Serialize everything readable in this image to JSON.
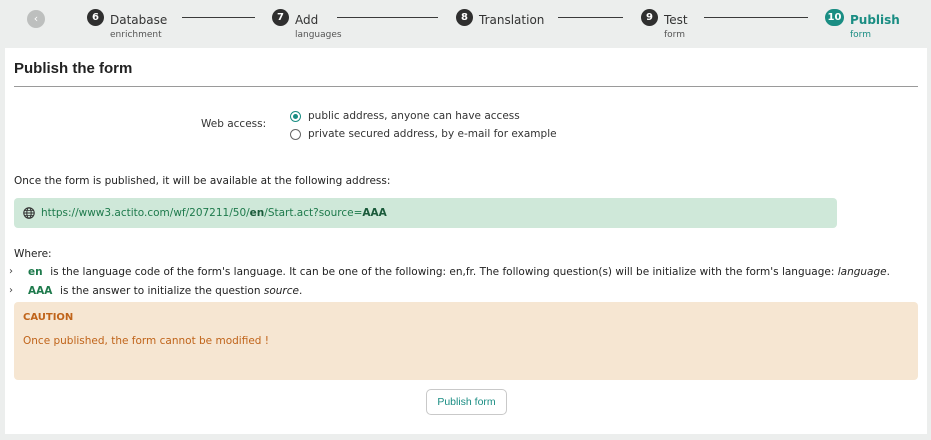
{
  "stepper": {
    "back_icon": "chevron-left-icon",
    "steps": [
      {
        "num": "6",
        "title": "Database",
        "sub": "enrichment"
      },
      {
        "num": "7",
        "title": "Add",
        "sub": "languages"
      },
      {
        "num": "8",
        "title": "Translation",
        "sub": ""
      },
      {
        "num": "9",
        "title": "Test",
        "sub": "form"
      },
      {
        "num": "10",
        "title": "Publish",
        "sub": "form"
      }
    ],
    "active_step": "10",
    "accent_color": "#1a8d83"
  },
  "page": {
    "title": "Publish the form"
  },
  "web_access": {
    "label": "Web access:",
    "options": [
      {
        "label": "public address, anyone can have access",
        "checked": true
      },
      {
        "label": "private secured address, by e-mail for example",
        "checked": false
      }
    ]
  },
  "address": {
    "intro": "Once the form is published, it will be available at the following address:",
    "icon": "globe-icon",
    "url_prefix": "https://www3.actito.com/wf/207211/50/",
    "url_lang": "en",
    "url_middle": "/Start.act?source=",
    "url_param": "AAA"
  },
  "where": {
    "label": "Where:",
    "items": [
      {
        "code": "en",
        "text": "is the language code of the form's language. It can be one of the following: en,fr. The following question(s) will be initialize with the form's language:",
        "emph": "language",
        "tail": "."
      },
      {
        "code": "AAA",
        "text": "is the answer to initialize the question",
        "emph": "source",
        "tail": "."
      }
    ]
  },
  "caution": {
    "title": "CAUTION",
    "message": "Once published, the form cannot be modified !",
    "color": "#c0641a"
  },
  "actions": {
    "publish_label": "Publish form"
  }
}
